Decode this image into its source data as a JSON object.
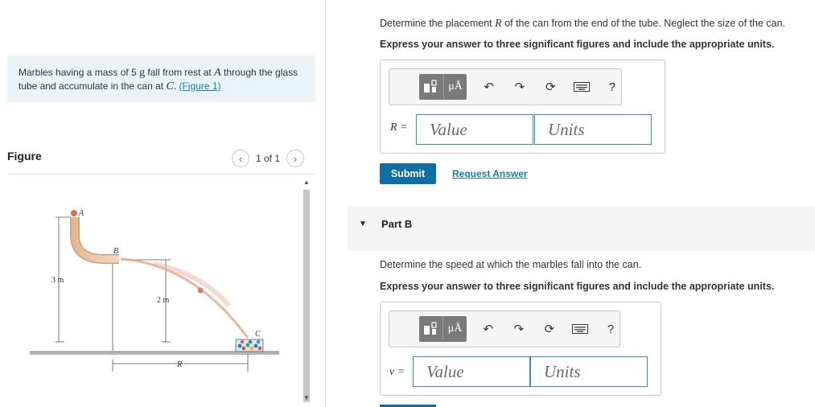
{
  "problem": {
    "text_pre": "Marbles having a mass of 5 ",
    "unit_g": "g",
    "text_mid": " fall from rest at ",
    "point_a": "A",
    "text_mid2": " through the glass tube and accumulate in the can at ",
    "point_c": "C",
    "text_end": ". ",
    "figure_link": "(Figure 1)"
  },
  "figure": {
    "title": "Figure",
    "pager_text": "1 of 1",
    "prev_icon": "chevron-left-icon",
    "next_icon": "chevron-right-icon",
    "labels": {
      "a": "A",
      "b": "B",
      "c": "C",
      "r": "R",
      "h3": "3 m",
      "h2": "2 m"
    }
  },
  "part_a": {
    "prompt": "Determine the placement ",
    "prompt_var": "R",
    "prompt_end": " of the can from the end of the tube. Neglect the size of the can.",
    "instruction": "Express your answer to three significant figures and include the appropriate units.",
    "var_label": "R =",
    "value_placeholder": "Value",
    "units_placeholder": "Units",
    "submit_label": "Submit",
    "request_label": "Request Answer"
  },
  "part_b": {
    "title": "Part B",
    "prompt": "Determine the speed at which the marbles fall into the can.",
    "instruction": "Express your answer to three significant figures and include the appropriate units.",
    "var_label": "v =",
    "value_placeholder": "Value",
    "units_placeholder": "Units"
  },
  "toolbar": {
    "template_icon": "template-icon",
    "units_label": "μÅ",
    "undo_icon": "undo-icon",
    "redo_icon": "redo-icon",
    "reset_icon": "reset-icon",
    "keyboard_icon": "keyboard-icon",
    "help_label": "?"
  },
  "colors": {
    "accent": "#1a7fa8",
    "submit": "#0e6fa3",
    "field_border": "#3a8fb7",
    "info_bg": "#e9f4f6"
  }
}
